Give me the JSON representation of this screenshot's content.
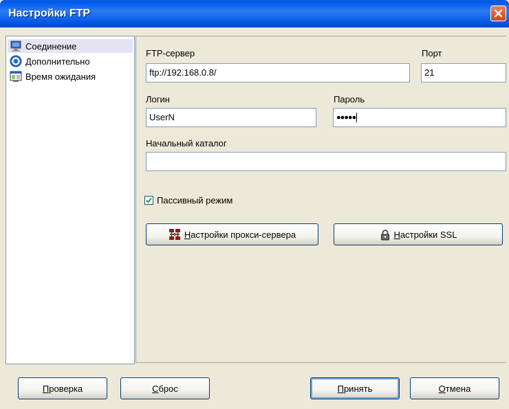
{
  "window": {
    "title": "Настройки FTP"
  },
  "tree": {
    "items": [
      {
        "label": "Соединение",
        "icon": "monitor-icon",
        "selected": true
      },
      {
        "label": "Дополнительно",
        "icon": "gear-icon",
        "selected": false
      },
      {
        "label": "Время ожидания",
        "icon": "timeout-window-icon",
        "selected": false
      }
    ]
  },
  "connection": {
    "server_label": "FTP-сервер",
    "server_value": "ftp://192.168.0.8/",
    "port_label": "Порт",
    "port_value": "21",
    "login_label": "Логин",
    "login_value": "UserN",
    "password_label": "Пароль",
    "password_value": "●●●●●",
    "dir_label": "Начальный каталог",
    "dir_value": "",
    "passive_label": "Пассивный режим",
    "passive_checked": true,
    "proxy_accel": "Н",
    "proxy_rest": "астройки прокси-сервера",
    "ssl_accel": "Н",
    "ssl_rest": "астройки SSL"
  },
  "footer": {
    "check_accel": "П",
    "check_rest": "роверка",
    "reset_accel": "С",
    "reset_rest": "брос",
    "accept_accel": "П",
    "accept_rest": "ринять",
    "cancel_accel": "О",
    "cancel_rest": "тмена"
  },
  "colors": {
    "titlebar": "#0058EE",
    "close": "#D0441A",
    "dialog_bg": "#ECE9D8"
  }
}
